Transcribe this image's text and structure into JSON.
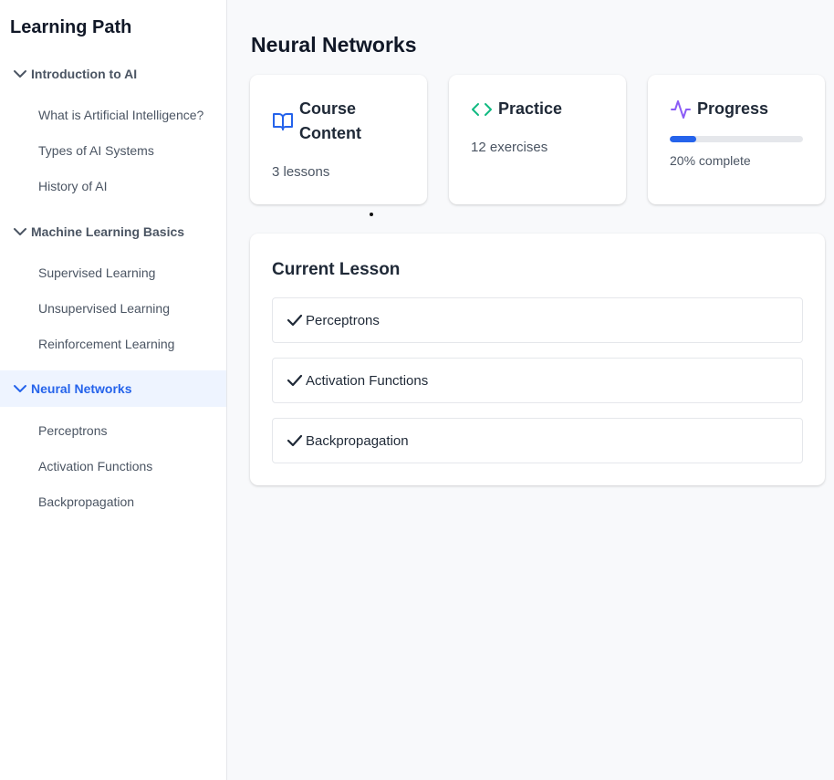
{
  "sidebar": {
    "title": "Learning Path",
    "sections": [
      {
        "label": "Introduction to AI",
        "expanded": true,
        "active": false,
        "items": [
          "What is Artificial Intelligence?",
          "Types of AI Systems",
          "History of AI"
        ]
      },
      {
        "label": "Machine Learning Basics",
        "expanded": true,
        "active": false,
        "items": [
          "Supervised Learning",
          "Unsupervised Learning",
          "Reinforcement Learning"
        ]
      },
      {
        "label": "Neural Networks",
        "expanded": true,
        "active": true,
        "items": [
          "Perceptrons",
          "Activation Functions",
          "Backpropagation"
        ]
      }
    ]
  },
  "main": {
    "title": "Neural Networks",
    "cards": {
      "content": {
        "icon": "book-open-icon",
        "title": "Course Content",
        "subtitle": "3 lessons"
      },
      "practice": {
        "icon": "code-icon",
        "title": "Practice",
        "subtitle": "12 exercises"
      },
      "progress": {
        "icon": "activity-icon",
        "title": "Progress",
        "subtitle": "20% complete",
        "value": 0.2
      }
    },
    "current_lesson": {
      "heading": "Current Lesson",
      "items": [
        "Perceptrons",
        "Activation Functions",
        "Backpropagation"
      ]
    }
  },
  "colors": {
    "accent": "#2563eb",
    "active_bg": "#eef4ff",
    "practice_icon": "#10b981",
    "progress_icon": "#8b5cf6"
  }
}
